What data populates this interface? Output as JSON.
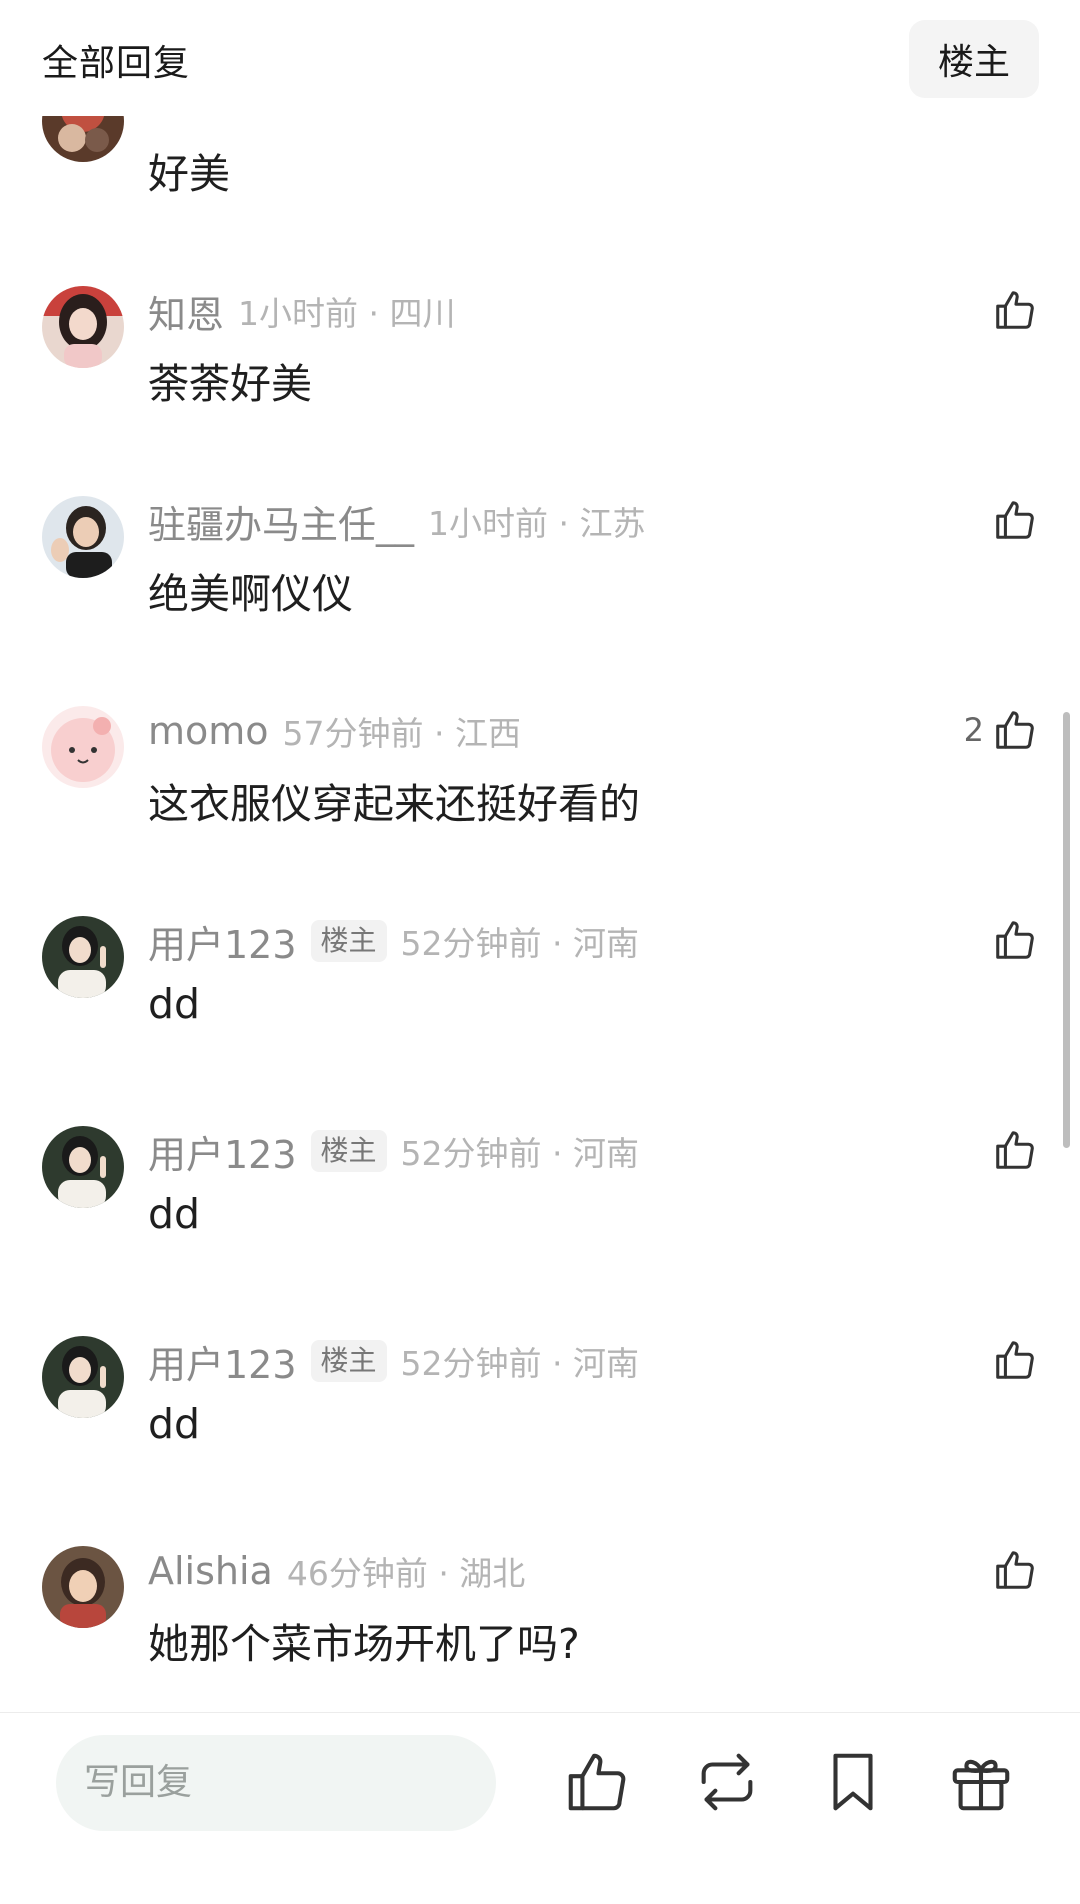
{
  "header": {
    "title": "全部回复",
    "op_filter_label": "楼主"
  },
  "comments": [
    {
      "author": "",
      "time_location": "",
      "text": "好美",
      "likes": ""
    },
    {
      "author": "知恩",
      "time_location": "1小时前 · 四川",
      "text": "荼荼好美",
      "likes": ""
    },
    {
      "author": "驻疆办马主任__",
      "time_location": "1小时前 · 江苏",
      "text": "绝美啊仪仪",
      "likes": ""
    },
    {
      "author": "momo",
      "time_location": "57分钟前 · 江西",
      "text": "这衣服仪穿起来还挺好看的",
      "likes": "2"
    },
    {
      "author": "用户123",
      "badge": "楼主",
      "time_location": "52分钟前 · 河南",
      "text": "dd",
      "likes": ""
    },
    {
      "author": "用户123",
      "badge": "楼主",
      "time_location": "52分钟前 · 河南",
      "text": "dd",
      "likes": ""
    },
    {
      "author": "用户123",
      "badge": "楼主",
      "time_location": "52分钟前 · 河南",
      "text": "dd",
      "likes": ""
    },
    {
      "author": "Alishia",
      "time_location": "46分钟前 · 湖北",
      "text": "她那个菜市场开机了吗?",
      "likes": ""
    }
  ],
  "bottom_bar": {
    "reply_placeholder": "写回复",
    "icons": [
      "like-icon",
      "repost-icon",
      "bookmark-icon",
      "gift-icon"
    ]
  },
  "colors": {
    "text_primary": "#1f1f1f",
    "text_secondary": "#8a8a8a",
    "text_meta": "#b4b4b4",
    "input_bg": "#f1f5f3"
  }
}
